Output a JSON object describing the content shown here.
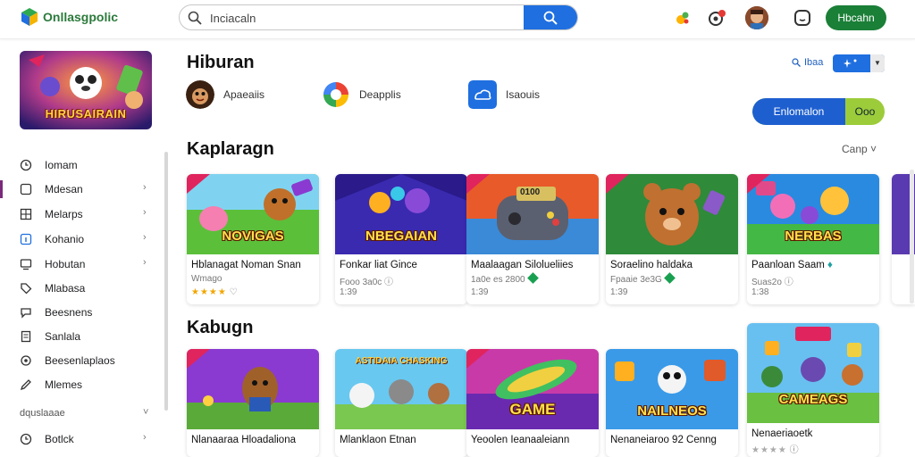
{
  "header": {
    "brand": "Onllasgpolic",
    "search_value": "Inciacaln",
    "signin_label": "Hbcahn",
    "colors": {
      "accent": "#1f6fe0",
      "brand_green": "#1a7f37"
    }
  },
  "sidebar": {
    "promo_title": "HIRUSAIRAIN",
    "items": [
      {
        "label": "Iomam",
        "icon": "clock-icon",
        "chevron": false
      },
      {
        "label": "Mdesan",
        "icon": "square-icon",
        "chevron": true
      },
      {
        "label": "Melarps",
        "icon": "grid-icon",
        "chevron": true
      },
      {
        "label": "Kohanio",
        "icon": "info-icon",
        "chevron": true
      },
      {
        "label": "Hobutan",
        "icon": "monitor-icon",
        "chevron": true
      },
      {
        "label": "Mlabasa",
        "icon": "tag-icon",
        "chevron": false
      },
      {
        "label": "Beesnens",
        "icon": "chat-icon",
        "chevron": false
      },
      {
        "label": "Sanlala",
        "icon": "doc-icon",
        "chevron": false
      },
      {
        "label": "Beesenlaplaos",
        "icon": "settings-icon",
        "chevron": false
      },
      {
        "label": "Mlemes",
        "icon": "pen-icon",
        "chevron": false
      }
    ],
    "section_label": "dquslaaae",
    "bottom_item": "Botlck"
  },
  "main": {
    "title": "Hiburan",
    "categories": [
      {
        "label": "Apaeaiis",
        "icon": "monkey-icon"
      },
      {
        "label": "Deapplis",
        "icon": "color-ring-icon"
      },
      {
        "label": "Isaouis",
        "icon": "cloud-icon"
      }
    ],
    "sort_label": "Ibaa",
    "pill_left": "Enlomalon",
    "pill_right": "Ooo",
    "section1_title": "Kaplaragn",
    "section1_link": "Canp",
    "section2_title": "Kabugn",
    "row1": [
      {
        "logo": "NOVIGAS",
        "title": "Hblanagat Noman Snan",
        "sub": "Wmago",
        "stars": "★★★★",
        "meta": "",
        "theme": "green"
      },
      {
        "logo": "NBEGAIAN",
        "title": "Fonkar liat Gince",
        "sub": "Fooo 3a0c",
        "stars": "",
        "meta": "1:39",
        "theme": "purple"
      },
      {
        "logo": "0100",
        "title": "Maalaagan Silolueliies",
        "sub": "1a0e es 2800",
        "stars": "",
        "meta": "1:39",
        "theme": "orange"
      },
      {
        "logo": "",
        "title": "Soraelino haldaka",
        "sub": "Fpaaie 3e3G",
        "stars": "",
        "meta": "1:39",
        "theme": "teal"
      },
      {
        "logo": "NERBAS",
        "title": "Paanloan Saam",
        "sub": "Suas2o",
        "stars": "",
        "meta": "1:38",
        "theme": "blue"
      }
    ],
    "row2": [
      {
        "logo": "",
        "title": "Nlanaaraa Hloadaliona",
        "sub": "",
        "theme": "purple2"
      },
      {
        "logo": "ASTIDAIA CHASKING",
        "title": "Mlanklaon Etnan",
        "sub": "",
        "theme": "sky"
      },
      {
        "logo": "GAME",
        "title": "Yeoolen Ieanaaleiann",
        "sub": "",
        "theme": "magenta"
      },
      {
        "logo": "NAILNEOS",
        "title": "Nenaneiaroo 92 Cenng",
        "sub": "",
        "theme": "azure"
      },
      {
        "logo": "CAMEAGS",
        "title": "Nenaeriaoetk",
        "sub": "",
        "stars": "★★★★",
        "theme": "sky2"
      }
    ]
  }
}
